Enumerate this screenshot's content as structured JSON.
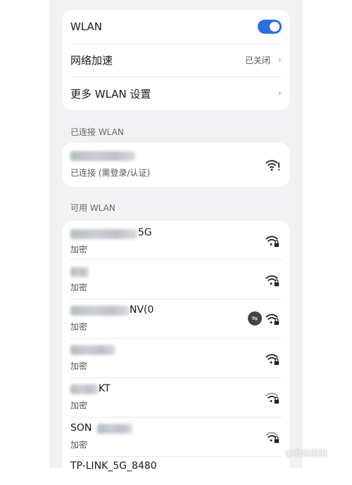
{
  "settings_card": {
    "wlan_label": "WLAN",
    "wlan_on": true,
    "boost_label": "网络加速",
    "boost_value": "已关闭",
    "more_label": "更多 WLAN 设置"
  },
  "connected_section": {
    "title": "已连接 WLAN",
    "network": {
      "status": "已连接 (需登录/认证)",
      "icon": "wifi-alert-icon"
    }
  },
  "available_section": {
    "title": "可用 WLAN",
    "networks": [
      {
        "name_visible": "5G",
        "security": "加密",
        "icon": "wifi-lock-icon"
      },
      {
        "name_visible": "",
        "security": "加密",
        "icon": "wifi-lock-icon"
      },
      {
        "name_visible": "NV(0",
        "security": "加密",
        "icon": "wifi-lock-icon",
        "extra_icon": "hotspot-icon"
      },
      {
        "name_visible": "",
        "security": "加密",
        "icon": "wifi-lock-icon"
      },
      {
        "name_visible": "KT",
        "security": "加密",
        "icon": "wifi-lock-icon"
      },
      {
        "name_visible": "SON",
        "security": "加密",
        "icon": "wifi-lock-icon"
      },
      {
        "name_visible": "TP-LINK_5G_8480",
        "security": "",
        "icon": "wifi-lock-icon"
      }
    ]
  },
  "watermark": "@乔妹懒懒",
  "colors": {
    "accent": "#2a6ee6",
    "page_bg": "#f2f2f4"
  }
}
